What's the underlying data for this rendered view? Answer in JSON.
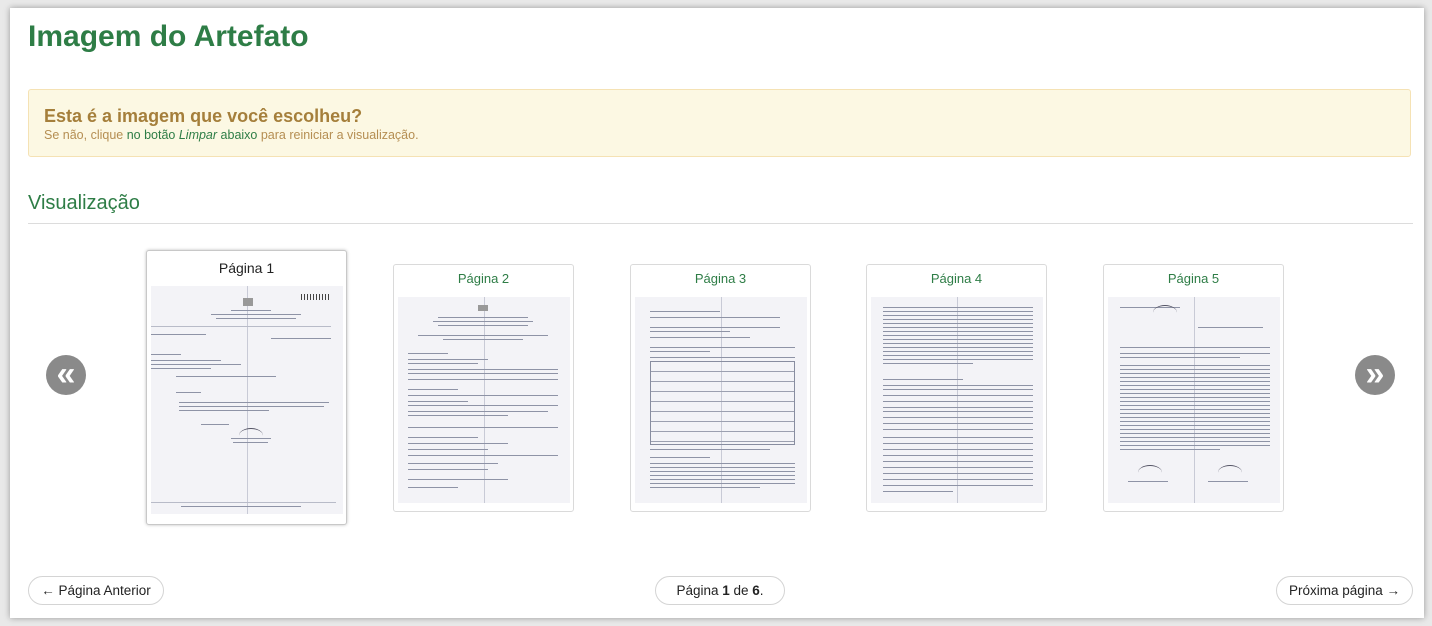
{
  "page": {
    "title": "Imagem do Artefato"
  },
  "alert": {
    "heading": "Esta é a imagem que você escolheu?",
    "text_before": "Se não, clique ",
    "text_strong": "no botão ",
    "text_em": "Limpar",
    "text_strong2": " abaixo",
    "text_after": " para reiniciar a visualização."
  },
  "preview": {
    "section_title": "Visualização",
    "prev_icon": "double-chevron-left-icon",
    "next_icon": "double-chevron-right-icon",
    "prev_glyph": "«",
    "next_glyph": "»",
    "thumbnails": [
      {
        "label": "Página 1",
        "active": true
      },
      {
        "label": "Página 2",
        "active": false
      },
      {
        "label": "Página 3",
        "active": false
      },
      {
        "label": "Página 4",
        "active": false
      },
      {
        "label": "Página 5",
        "active": false
      }
    ]
  },
  "pager": {
    "prev_label": "← Página Anterior",
    "next_label": "Próxima página →",
    "indicator_prefix": "Página ",
    "current": "1",
    "indicator_mid": " de ",
    "total": "6",
    "indicator_suffix": "."
  },
  "colors": {
    "accent": "#2e7d46",
    "alert_bg": "#fcf8e3",
    "alert_heading": "#a57f3b",
    "arrow": "#8a8a8a"
  }
}
